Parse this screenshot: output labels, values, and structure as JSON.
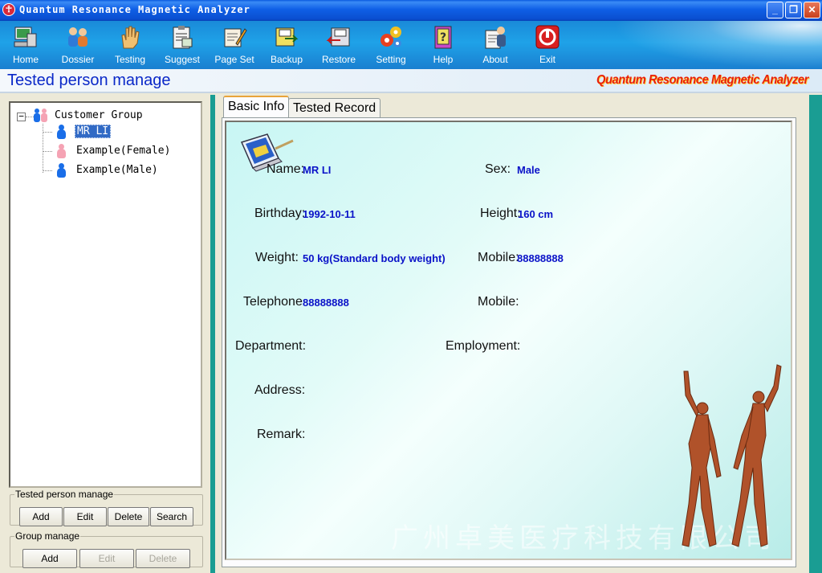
{
  "window": {
    "title": "Quantum Resonance Magnetic Analyzer",
    "controls": {
      "minimize": "_",
      "maximize": "❐",
      "close": "✕"
    }
  },
  "toolbar": {
    "items": [
      {
        "label": "Home",
        "icon": "home-icon"
      },
      {
        "label": "Dossier",
        "icon": "dossier-icon"
      },
      {
        "label": "Testing",
        "icon": "hand-icon"
      },
      {
        "label": "Suggest",
        "icon": "clipboard-icon"
      },
      {
        "label": "Page Set",
        "icon": "pageset-icon"
      },
      {
        "label": "Backup",
        "icon": "backup-icon"
      },
      {
        "label": "Restore",
        "icon": "restore-icon"
      },
      {
        "label": "Setting",
        "icon": "gears-icon"
      },
      {
        "label": "Help",
        "icon": "help-book-icon"
      },
      {
        "label": "About",
        "icon": "about-icon"
      },
      {
        "label": "Exit",
        "icon": "power-icon"
      }
    ]
  },
  "header": {
    "title": "Tested person manage",
    "brand": "Quantum Resonance Magnetic Analyzer"
  },
  "tree": {
    "root": "Customer Group",
    "expander": "−",
    "items": [
      {
        "label": "MR LI",
        "gender": "male",
        "selected": true
      },
      {
        "label": "Example(Female)",
        "gender": "female",
        "selected": false
      },
      {
        "label": "Example(Male)",
        "gender": "male",
        "selected": false
      }
    ]
  },
  "person_group": {
    "legend": "Tested person manage",
    "buttons": [
      "Add",
      "Edit",
      "Delete",
      "Search"
    ]
  },
  "group_manage": {
    "legend": "Group manage",
    "buttons": [
      {
        "label": "Add",
        "enabled": true
      },
      {
        "label": "Edit",
        "enabled": false
      },
      {
        "label": "Delete",
        "enabled": false
      }
    ]
  },
  "tabs": [
    "Basic Info",
    "Tested Record"
  ],
  "basic_info": {
    "name_label": "Name:",
    "name": "MR LI",
    "sex_label": "Sex:",
    "sex": "Male",
    "birthday_label": "Birthday:",
    "birthday": "1992-10-11",
    "height_label": "Height:",
    "height": "160 cm",
    "weight_label": "Weight:",
    "weight": "50 kg(Standard body weight)",
    "mobile_label": "Mobile:",
    "mobile": "88888888",
    "telephone_label": "Telephone",
    "telephone": "88888888",
    "mobile2_label": "Mobile:",
    "department_label": "Department:",
    "employment_label": "Employment:",
    "address_label": "Address:",
    "remark_label": "Remark:"
  },
  "watermark": "广州卓美医疗科技有限公司"
}
